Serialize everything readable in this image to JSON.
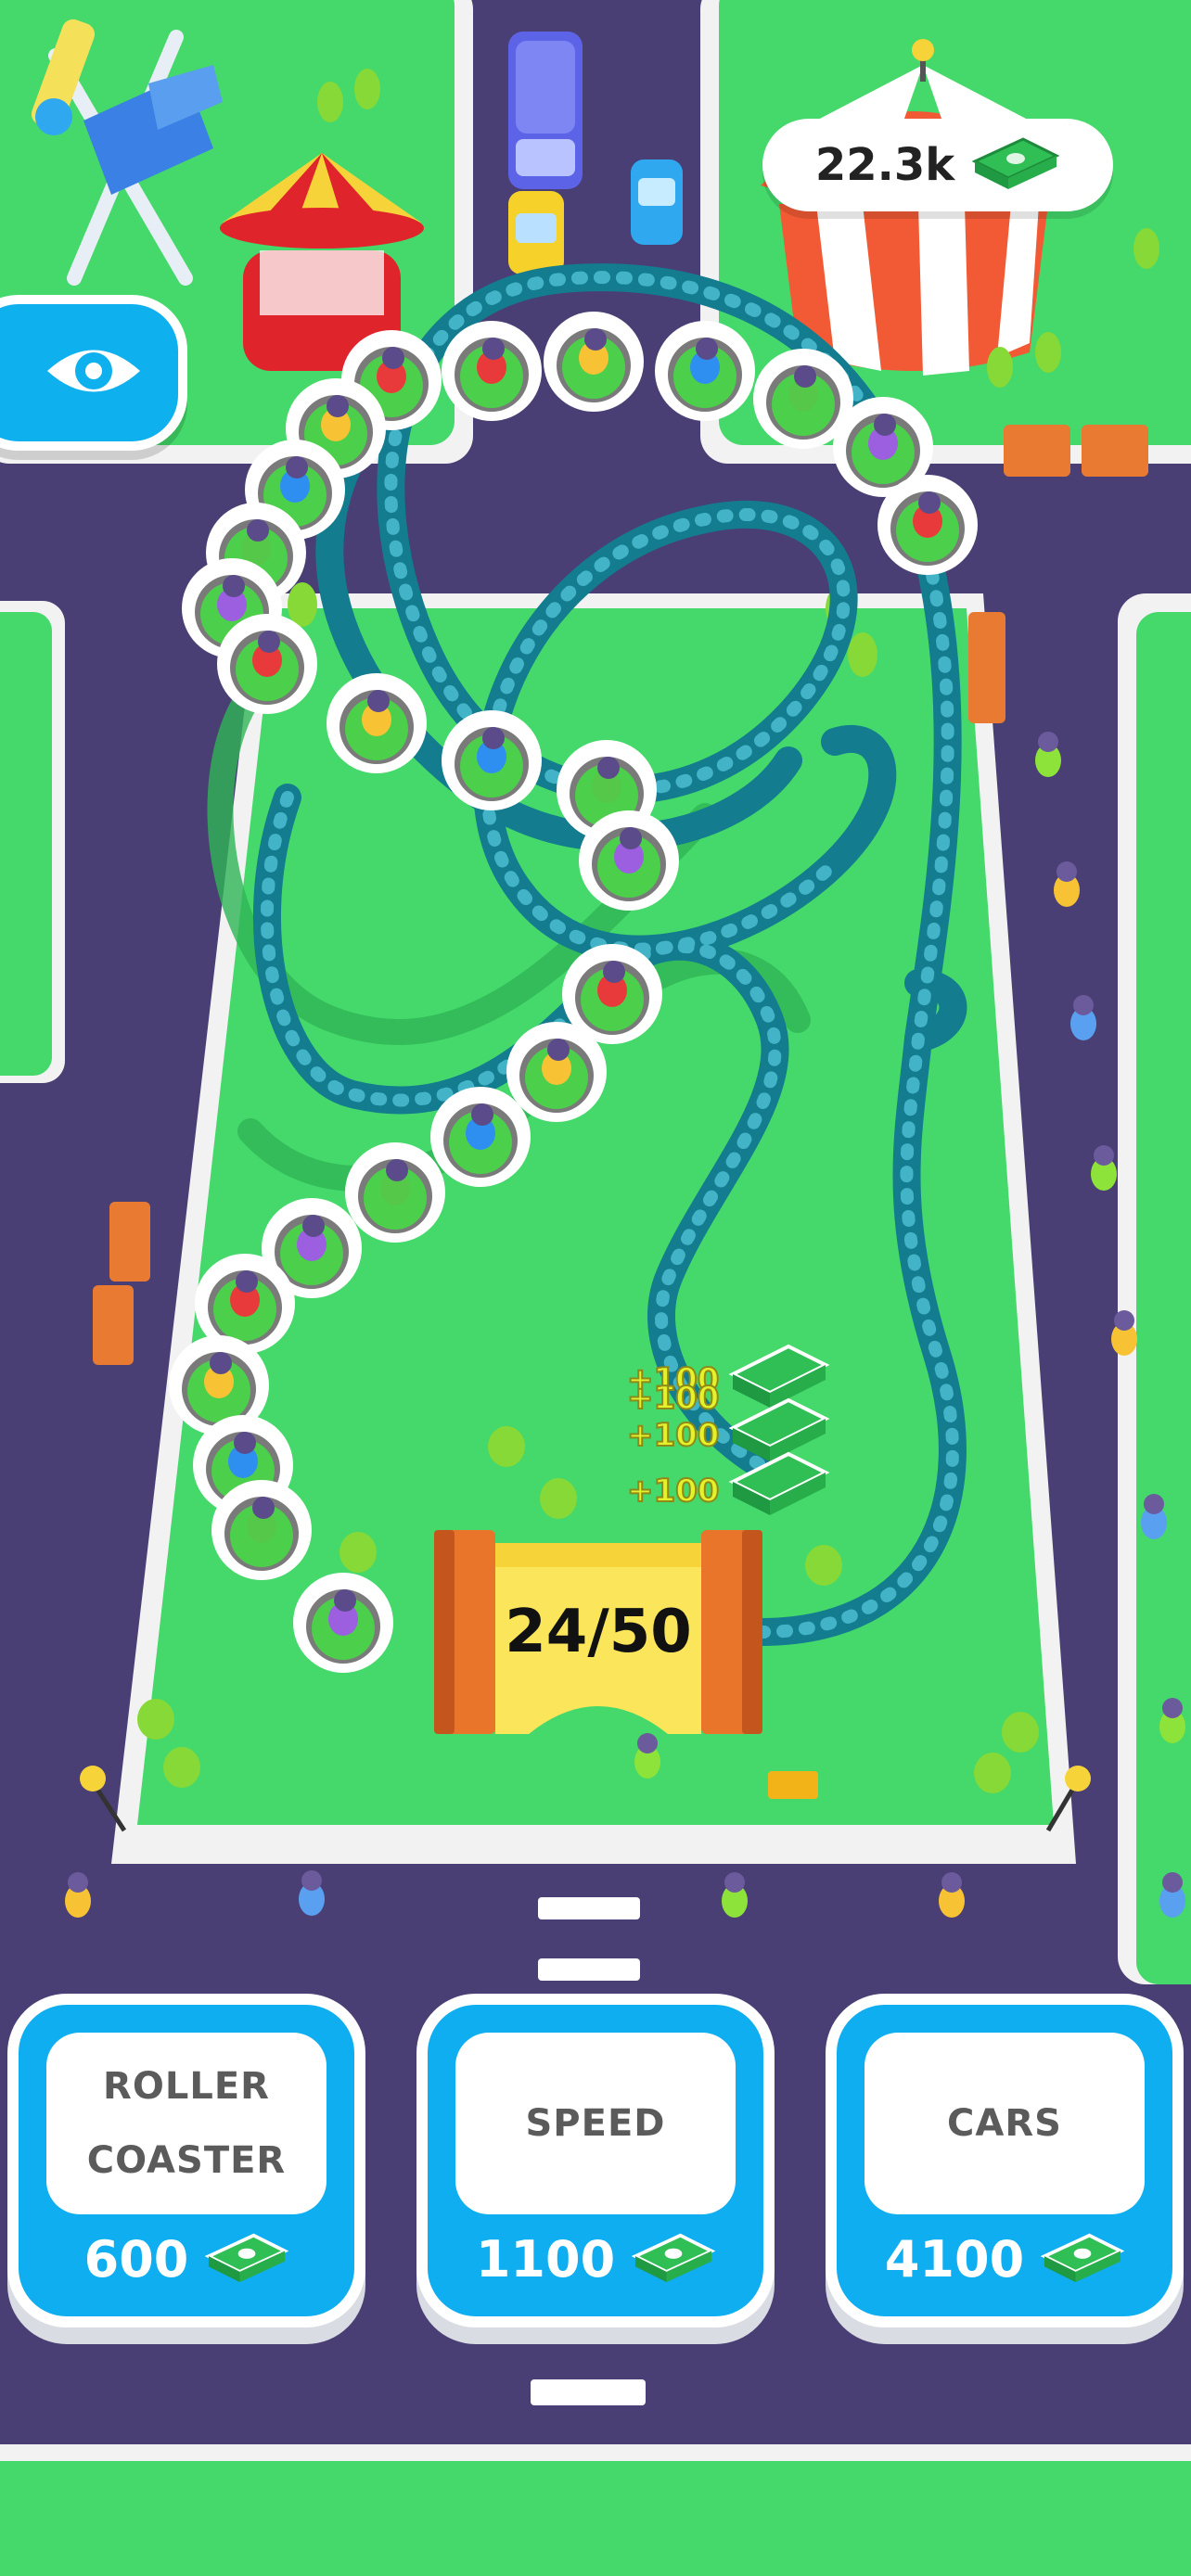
{
  "hud": {
    "money": "22.3k",
    "money_icon": "cash-stack-icon",
    "view_icon": "eye-icon"
  },
  "ride": {
    "queue_counter": "24/50"
  },
  "payouts": [
    "+100",
    "+100",
    "+100",
    "+100"
  ],
  "upgrades": [
    {
      "label": "ROLLER\nCOASTER",
      "price": "600"
    },
    {
      "label": "SPEED",
      "price": "1100"
    },
    {
      "label": "CARS",
      "price": "4100"
    }
  ],
  "colors": {
    "grass": "#44d96a",
    "road": "#4a3f74",
    "track": "#137c8f",
    "button": "#0eaef0",
    "counter_frame": "#e8752a"
  }
}
